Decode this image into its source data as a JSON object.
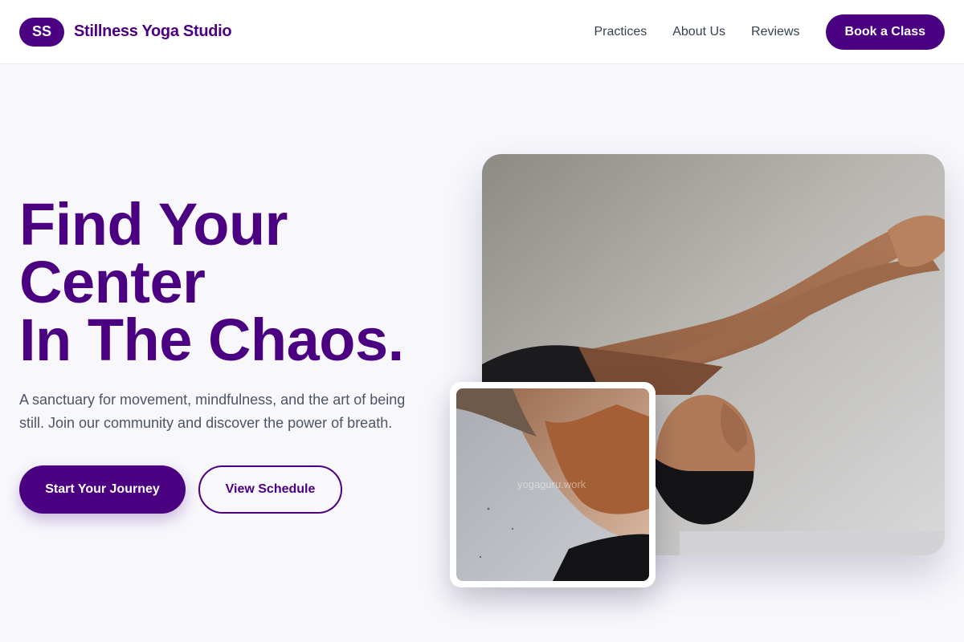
{
  "header": {
    "logo_initials": "SS",
    "brand_name": "Stillness Yoga Studio",
    "nav": [
      {
        "label": "Practices"
      },
      {
        "label": "About Us"
      },
      {
        "label": "Reviews"
      }
    ],
    "cta_label": "Book a Class"
  },
  "hero": {
    "title_lines": [
      "Find Your",
      "Center",
      "In The Chaos."
    ],
    "subtitle": "A sanctuary for movement, mindfulness, and the art of being still. Join our community and discover the power of breath.",
    "primary_button": "Start Your Journey",
    "secondary_button": "View Schedule"
  },
  "images": {
    "main_alt": "woman in deep yoga backbend with arms extended",
    "overlay_alt": "close-up of yoga practitioner torso in rust sports top",
    "watermark": "yogaguru.work"
  },
  "colors": {
    "brand": "#4b0082",
    "background": "#f7f7fc",
    "text_muted": "#4b5563"
  }
}
